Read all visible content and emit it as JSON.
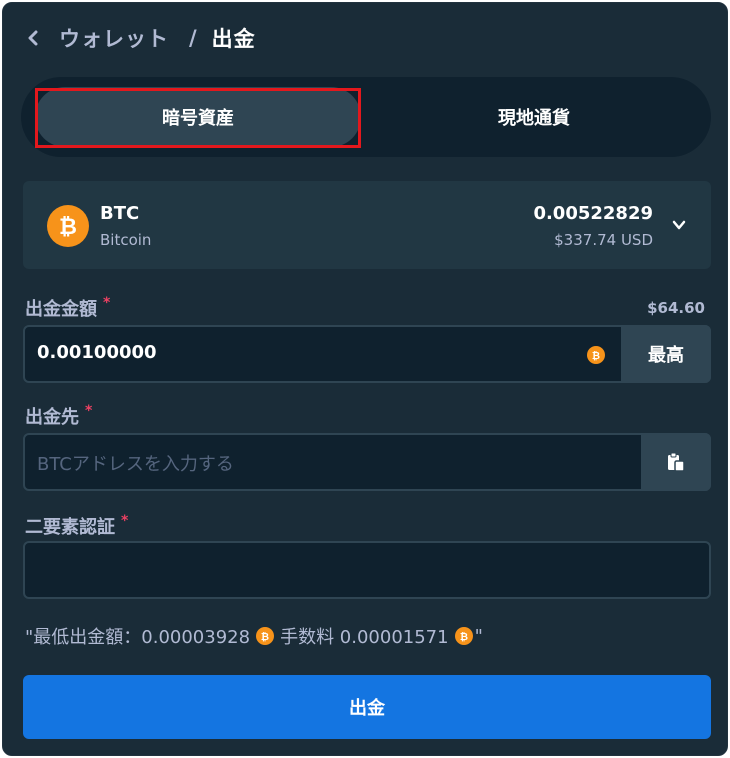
{
  "header": {
    "parent": "ウォレット",
    "separator": "/",
    "current": "出金"
  },
  "tabs": [
    {
      "label": "暗号資産",
      "active": true
    },
    {
      "label": "現地通貨",
      "active": false
    }
  ],
  "currency": {
    "code": "BTC",
    "name": "Bitcoin",
    "amount": "0.00522829",
    "usd": "$337.74 USD",
    "icon": "bitcoin-icon"
  },
  "amount_field": {
    "label": "出金金額",
    "required": "*",
    "usd_value": "$64.60",
    "value": "0.00100000",
    "max_label": "最高"
  },
  "address_field": {
    "label": "出金先",
    "required": "*",
    "placeholder": "BTCアドレスを入力する",
    "value": ""
  },
  "twofa_field": {
    "label": "二要素認証",
    "required": "*",
    "value": ""
  },
  "fee": {
    "prefix": "\"最低出金額：0.00003928",
    "middle": "手数料 0.00001571",
    "suffix": "\""
  },
  "submit_label": "出金",
  "colors": {
    "panel": "#1a2c38",
    "input": "#0f212e",
    "accent": "#1475e1",
    "bitcoin": "#f7931a",
    "highlight": "#e3181d",
    "required": "#ed4163"
  }
}
